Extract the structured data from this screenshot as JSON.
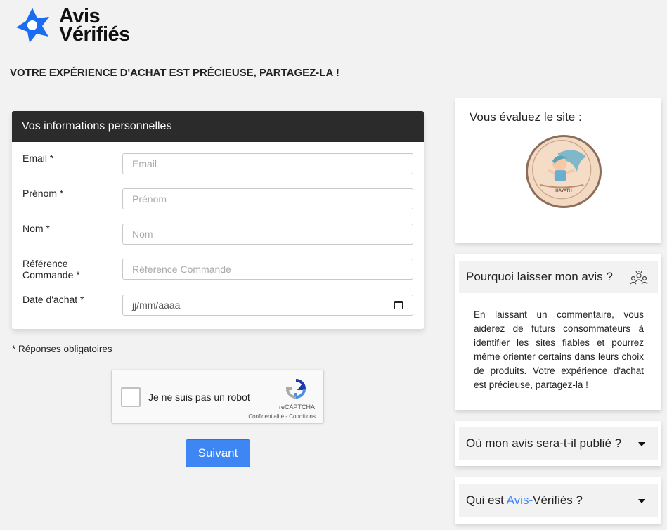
{
  "brand": {
    "line1": "Avis",
    "line2": "Vérifiés",
    "accent_color": "#1a6cf0"
  },
  "headline": "VOTRE EXPÉRIENCE D'ACHAT EST PRÉCIEUSE, PARTAGEZ-LA !",
  "form": {
    "title": "Vos informations personnelles",
    "fields": [
      {
        "label": "Email *",
        "placeholder": "Email"
      },
      {
        "label": "Prénom *",
        "placeholder": "Prénom"
      },
      {
        "label": "Nom *",
        "placeholder": "Nom"
      },
      {
        "label": "Référence Commande *",
        "placeholder": "Référence Commande"
      },
      {
        "label": "Date d'achat *",
        "placeholder": "jj/mm/aaaa"
      }
    ]
  },
  "required_note": "* Réponses obligatoires",
  "captcha": {
    "label": "Je ne suis pas un robot",
    "brand": "reCAPTCHA",
    "links": "Confidentialité - Conditions"
  },
  "next_button": "Suivant",
  "sidebar": {
    "evaluate_title": "Vous évaluez le site :",
    "badge_text": "HAYATH",
    "why": {
      "title": "Pourquoi laisser mon avis ?",
      "text": "En laissant un commentaire, vous aiderez de futurs consommateurs à identifier les sites fiables et pourrez même orienter certains dans leurs choix de produits. Votre expérience d'achat est précieuse, partagez-la !"
    },
    "where": {
      "title": "Où mon avis sera-t-il publié ?"
    },
    "who": {
      "title_prefix": "Qui est ",
      "title_accent": "Avis-",
      "title_suffix": "Vérifiés ?"
    }
  }
}
